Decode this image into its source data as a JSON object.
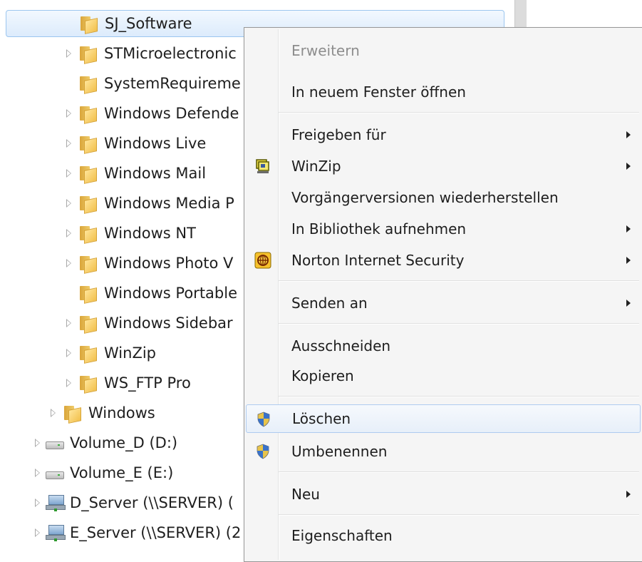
{
  "tree": {
    "items": [
      {
        "label": "SJ_Software",
        "type": "folder",
        "arrow": false,
        "selected": true
      },
      {
        "label": "STMicroelectronic",
        "type": "folder",
        "arrow": true
      },
      {
        "label": "SystemRequireme",
        "type": "folder",
        "arrow": false
      },
      {
        "label": "Windows Defende",
        "type": "folder",
        "arrow": true
      },
      {
        "label": "Windows Live",
        "type": "folder",
        "arrow": true
      },
      {
        "label": "Windows Mail",
        "type": "folder",
        "arrow": true
      },
      {
        "label": "Windows Media P",
        "type": "folder",
        "arrow": true
      },
      {
        "label": "Windows NT",
        "type": "folder",
        "arrow": true
      },
      {
        "label": "Windows Photo V",
        "type": "folder",
        "arrow": true
      },
      {
        "label": "Windows Portable",
        "type": "folder",
        "arrow": false
      },
      {
        "label": "Windows Sidebar",
        "type": "folder",
        "arrow": true
      },
      {
        "label": "WinZip",
        "type": "folder",
        "arrow": true
      },
      {
        "label": "WS_FTP Pro",
        "type": "folder",
        "arrow": true
      },
      {
        "label": "Windows",
        "type": "folder",
        "arrow": true
      },
      {
        "label": "Volume_D (D:)",
        "type": "drive",
        "arrow": true
      },
      {
        "label": "Volume_E (E:)",
        "type": "drive",
        "arrow": true
      },
      {
        "label": "D_Server (\\\\SERVER) (",
        "type": "netdrive",
        "arrow": true
      },
      {
        "label": "E_Server (\\\\SERVER) (2",
        "type": "netdrive",
        "arrow": true
      }
    ]
  },
  "context_menu": {
    "items": [
      {
        "label": "Erweitern",
        "disabled": true
      },
      {
        "label": "In neuem Fenster öffnen"
      },
      {
        "label": "Freigeben für",
        "submenu": true
      },
      {
        "label": "WinZip",
        "submenu": true,
        "icon": "winzip-icon"
      },
      {
        "label": "Vorgängerversionen wiederherstellen"
      },
      {
        "label": "In Bibliothek aufnehmen",
        "submenu": true
      },
      {
        "label": "Norton Internet Security",
        "submenu": true,
        "icon": "norton-icon"
      },
      {
        "label": "Senden an",
        "submenu": true
      },
      {
        "label": "Ausschneiden"
      },
      {
        "label": "Kopieren"
      },
      {
        "label": "Löschen",
        "icon": "uac-shield-icon",
        "hover": true
      },
      {
        "label": "Umbenennen",
        "icon": "uac-shield-icon"
      },
      {
        "label": "Neu",
        "submenu": true
      },
      {
        "label": "Eigenschaften"
      }
    ]
  },
  "colors": {
    "selection_border": "#9cc6ef",
    "menu_background": "#f5f5f5",
    "disabled_text": "#8d8d8d"
  }
}
